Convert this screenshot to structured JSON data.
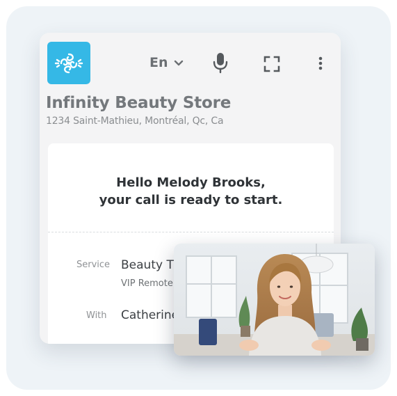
{
  "header": {
    "logo_icon": "swirl-ornament-icon",
    "language": "En",
    "icons": [
      "chevron-down-icon",
      "microphone-icon",
      "fullscreen-icon",
      "more-vertical-icon"
    ]
  },
  "store": {
    "name": "Infinity Beauty Store",
    "address": "1234 Saint-Mathieu, Montréal, Qc, Ca"
  },
  "greeting": {
    "line1": "Hello Melody Brooks,",
    "line2": "your call is ready to start."
  },
  "details": {
    "service_label": "Service",
    "service_value": "Beauty Ti",
    "service_sub": "VIP Remote",
    "with_label": "With",
    "with_value": "Catherine"
  },
  "colors": {
    "brand": "#35b8e6",
    "background": "#eef3f7"
  }
}
